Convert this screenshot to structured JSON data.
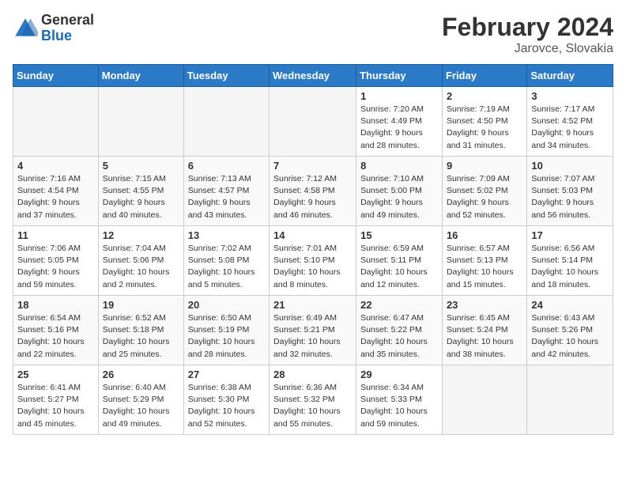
{
  "header": {
    "logo_line1": "General",
    "logo_line2": "Blue",
    "title": "February 2024",
    "subtitle": "Jarovce, Slovakia"
  },
  "weekdays": [
    "Sunday",
    "Monday",
    "Tuesday",
    "Wednesday",
    "Thursday",
    "Friday",
    "Saturday"
  ],
  "weeks": [
    [
      {
        "day": "",
        "info": ""
      },
      {
        "day": "",
        "info": ""
      },
      {
        "day": "",
        "info": ""
      },
      {
        "day": "",
        "info": ""
      },
      {
        "day": "1",
        "info": "Sunrise: 7:20 AM\nSunset: 4:49 PM\nDaylight: 9 hours\nand 28 minutes."
      },
      {
        "day": "2",
        "info": "Sunrise: 7:19 AM\nSunset: 4:50 PM\nDaylight: 9 hours\nand 31 minutes."
      },
      {
        "day": "3",
        "info": "Sunrise: 7:17 AM\nSunset: 4:52 PM\nDaylight: 9 hours\nand 34 minutes."
      }
    ],
    [
      {
        "day": "4",
        "info": "Sunrise: 7:16 AM\nSunset: 4:54 PM\nDaylight: 9 hours\nand 37 minutes."
      },
      {
        "day": "5",
        "info": "Sunrise: 7:15 AM\nSunset: 4:55 PM\nDaylight: 9 hours\nand 40 minutes."
      },
      {
        "day": "6",
        "info": "Sunrise: 7:13 AM\nSunset: 4:57 PM\nDaylight: 9 hours\nand 43 minutes."
      },
      {
        "day": "7",
        "info": "Sunrise: 7:12 AM\nSunset: 4:58 PM\nDaylight: 9 hours\nand 46 minutes."
      },
      {
        "day": "8",
        "info": "Sunrise: 7:10 AM\nSunset: 5:00 PM\nDaylight: 9 hours\nand 49 minutes."
      },
      {
        "day": "9",
        "info": "Sunrise: 7:09 AM\nSunset: 5:02 PM\nDaylight: 9 hours\nand 52 minutes."
      },
      {
        "day": "10",
        "info": "Sunrise: 7:07 AM\nSunset: 5:03 PM\nDaylight: 9 hours\nand 56 minutes."
      }
    ],
    [
      {
        "day": "11",
        "info": "Sunrise: 7:06 AM\nSunset: 5:05 PM\nDaylight: 9 hours\nand 59 minutes."
      },
      {
        "day": "12",
        "info": "Sunrise: 7:04 AM\nSunset: 5:06 PM\nDaylight: 10 hours\nand 2 minutes."
      },
      {
        "day": "13",
        "info": "Sunrise: 7:02 AM\nSunset: 5:08 PM\nDaylight: 10 hours\nand 5 minutes."
      },
      {
        "day": "14",
        "info": "Sunrise: 7:01 AM\nSunset: 5:10 PM\nDaylight: 10 hours\nand 8 minutes."
      },
      {
        "day": "15",
        "info": "Sunrise: 6:59 AM\nSunset: 5:11 PM\nDaylight: 10 hours\nand 12 minutes."
      },
      {
        "day": "16",
        "info": "Sunrise: 6:57 AM\nSunset: 5:13 PM\nDaylight: 10 hours\nand 15 minutes."
      },
      {
        "day": "17",
        "info": "Sunrise: 6:56 AM\nSunset: 5:14 PM\nDaylight: 10 hours\nand 18 minutes."
      }
    ],
    [
      {
        "day": "18",
        "info": "Sunrise: 6:54 AM\nSunset: 5:16 PM\nDaylight: 10 hours\nand 22 minutes."
      },
      {
        "day": "19",
        "info": "Sunrise: 6:52 AM\nSunset: 5:18 PM\nDaylight: 10 hours\nand 25 minutes."
      },
      {
        "day": "20",
        "info": "Sunrise: 6:50 AM\nSunset: 5:19 PM\nDaylight: 10 hours\nand 28 minutes."
      },
      {
        "day": "21",
        "info": "Sunrise: 6:49 AM\nSunset: 5:21 PM\nDaylight: 10 hours\nand 32 minutes."
      },
      {
        "day": "22",
        "info": "Sunrise: 6:47 AM\nSunset: 5:22 PM\nDaylight: 10 hours\nand 35 minutes."
      },
      {
        "day": "23",
        "info": "Sunrise: 6:45 AM\nSunset: 5:24 PM\nDaylight: 10 hours\nand 38 minutes."
      },
      {
        "day": "24",
        "info": "Sunrise: 6:43 AM\nSunset: 5:26 PM\nDaylight: 10 hours\nand 42 minutes."
      }
    ],
    [
      {
        "day": "25",
        "info": "Sunrise: 6:41 AM\nSunset: 5:27 PM\nDaylight: 10 hours\nand 45 minutes."
      },
      {
        "day": "26",
        "info": "Sunrise: 6:40 AM\nSunset: 5:29 PM\nDaylight: 10 hours\nand 49 minutes."
      },
      {
        "day": "27",
        "info": "Sunrise: 6:38 AM\nSunset: 5:30 PM\nDaylight: 10 hours\nand 52 minutes."
      },
      {
        "day": "28",
        "info": "Sunrise: 6:36 AM\nSunset: 5:32 PM\nDaylight: 10 hours\nand 55 minutes."
      },
      {
        "day": "29",
        "info": "Sunrise: 6:34 AM\nSunset: 5:33 PM\nDaylight: 10 hours\nand 59 minutes."
      },
      {
        "day": "",
        "info": ""
      },
      {
        "day": "",
        "info": ""
      }
    ]
  ]
}
